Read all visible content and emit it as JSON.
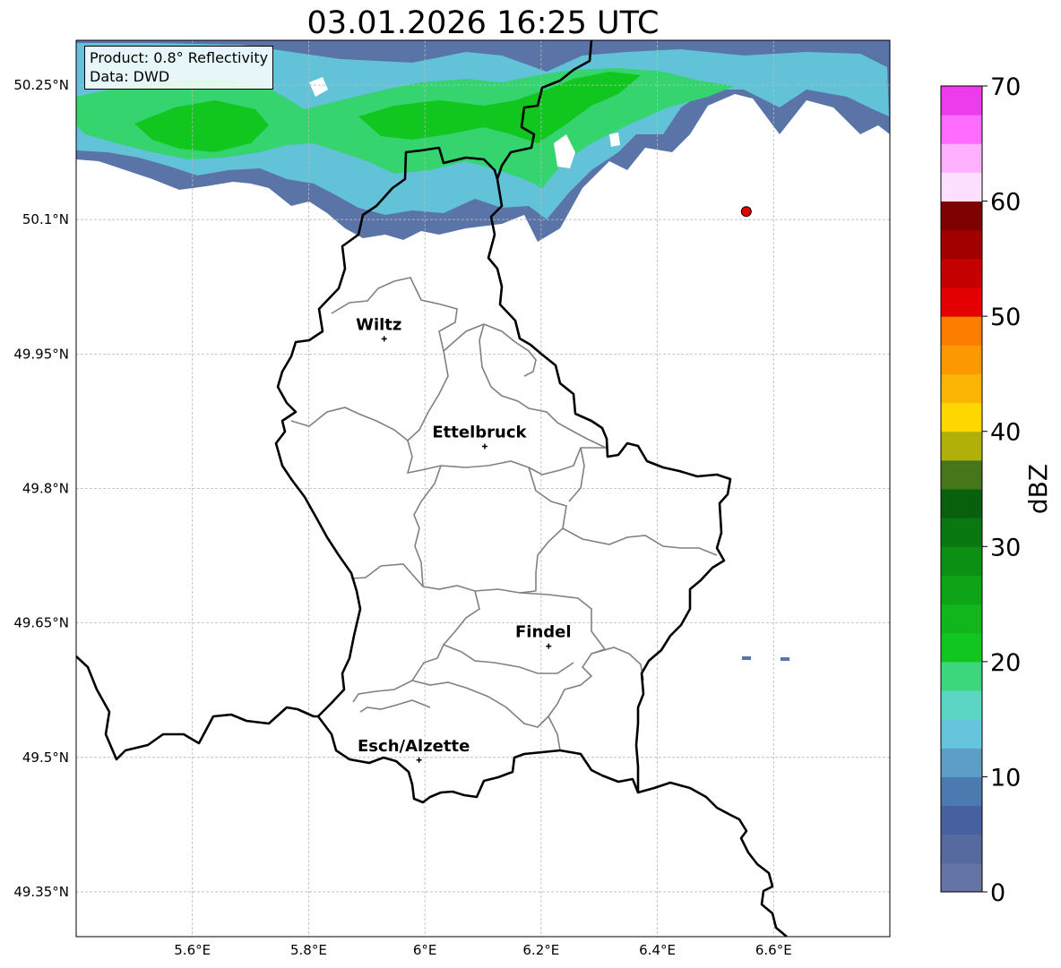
{
  "title": "03.01.2026 16:25 UTC",
  "info": {
    "product": "Product: 0.8° Reflectivity",
    "data": "Data: DWD"
  },
  "map": {
    "lon_range": [
      5.4,
      6.8
    ],
    "lat_range": [
      49.3,
      50.3
    ],
    "x_ticks": [
      {
        "value": 5.6,
        "label": "5.6°E"
      },
      {
        "value": 5.8,
        "label": "5.8°E"
      },
      {
        "value": 6.0,
        "label": "6°E"
      },
      {
        "value": 6.2,
        "label": "6.2°E"
      },
      {
        "value": 6.4,
        "label": "6.4°E"
      },
      {
        "value": 6.6,
        "label": "6.6°E"
      }
    ],
    "y_ticks": [
      {
        "value": 50.25,
        "label": "50.25°N"
      },
      {
        "value": 50.1,
        "label": "50.1°N"
      },
      {
        "value": 49.95,
        "label": "49.95°N"
      },
      {
        "value": 49.8,
        "label": "49.8°N"
      },
      {
        "value": 49.65,
        "label": "49.65°N"
      },
      {
        "value": 49.5,
        "label": "49.5°N"
      },
      {
        "value": 49.35,
        "label": "49.35°N"
      }
    ],
    "grid": true,
    "cities": [
      {
        "name": "Wiltz",
        "lon": 5.93,
        "lat": 49.967
      },
      {
        "name": "Ettelbruck",
        "lon": 6.103,
        "lat": 49.847
      },
      {
        "name": "Findel",
        "lon": 6.213,
        "lat": 49.624
      },
      {
        "name": "Esch/Alzette",
        "lon": 5.99,
        "lat": 49.497
      }
    ],
    "marker": {
      "lon": 6.553,
      "lat": 50.109,
      "color": "#e00000"
    }
  },
  "colorbar": {
    "label": "dBZ",
    "min": 0,
    "max": 70,
    "ticks": [
      0,
      10,
      20,
      30,
      40,
      50,
      60,
      70
    ],
    "colors": [
      "#6474a4",
      "#566aa0",
      "#4660a0",
      "#4a7ab0",
      "#5c9ec6",
      "#66c4dc",
      "#5cd6c4",
      "#3cd67c",
      "#12c620",
      "#10b61c",
      "#0ea418",
      "#0c9014",
      "#0a7810",
      "#08600c",
      "#46761a",
      "#b0b00a",
      "#fed600",
      "#fcb404",
      "#fc9802",
      "#fc7c00",
      "#e20000",
      "#c40000",
      "#a20000",
      "#7e0000",
      "#ffdfff",
      "#ffb0ff",
      "#ff6cff",
      "#ec3cec"
    ]
  }
}
